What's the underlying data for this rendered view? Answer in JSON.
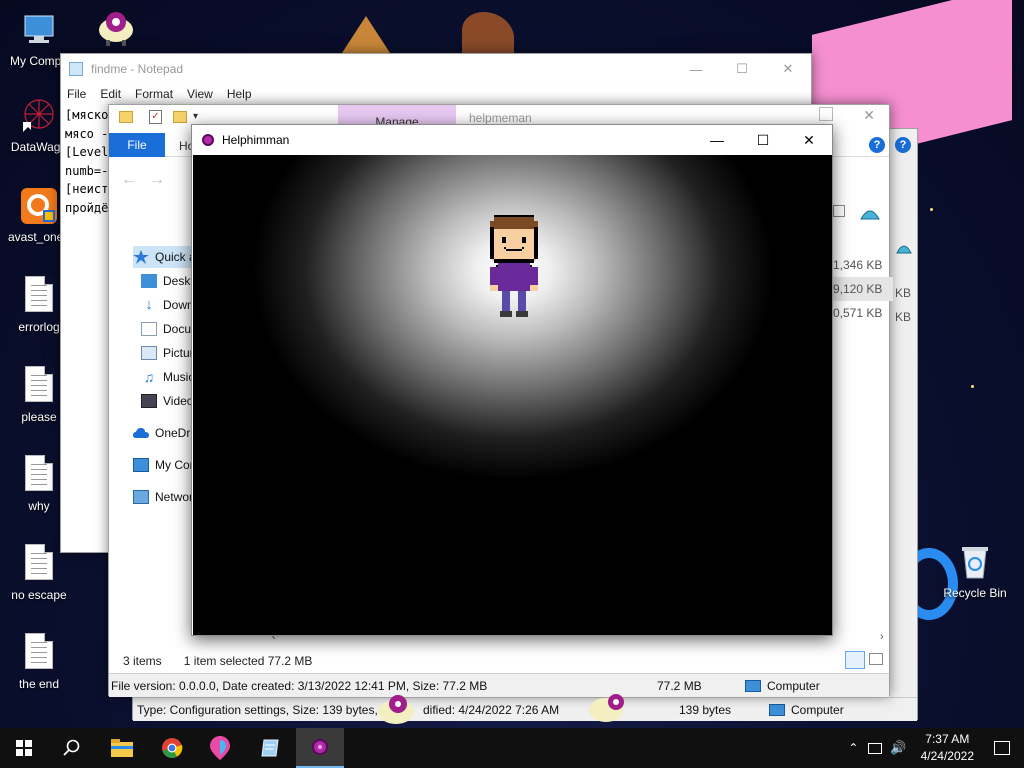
{
  "desktop": {
    "icons": [
      {
        "label": "My Compu",
        "icon": "computer-icon"
      },
      {
        "label": "DataWago",
        "icon": "datawagon-icon"
      },
      {
        "label": "avast_one_",
        "icon": "avast-icon"
      },
      {
        "label": "errorlog",
        "icon": "document-icon"
      },
      {
        "label": "please",
        "icon": "document-icon"
      },
      {
        "label": "why",
        "icon": "document-icon"
      },
      {
        "label": "no escape",
        "icon": "document-icon"
      },
      {
        "label": "the end",
        "icon": "document-icon"
      },
      {
        "label": "Recycle Bin",
        "icon": "recycle-bin-icon"
      }
    ]
  },
  "notepad": {
    "title": "findme - Notepad",
    "menu": [
      "File",
      "Edit",
      "Format",
      "View",
      "Help"
    ],
    "lines": [
      "[мяско",
      "мясо -",
      "[Level",
      "numb=-",
      "[неист",
      "пройдё"
    ]
  },
  "explorer_back": {
    "details": {
      "type_text": "Type: Configuration settings, Size: 139 bytes, D",
      "modified_text": "dified: 4/24/2022 7:26 AM",
      "size": "139 bytes",
      "location": "Computer"
    }
  },
  "explorer": {
    "manage_tab": "Manage",
    "title": "helpmeman",
    "file_tab": "File",
    "home_tab": "Ho",
    "nav": [
      "Quick a",
      "Deskt",
      "Down",
      "Docu",
      "Pictur",
      "Music",
      "Video",
      "OneDriv",
      "My Cor",
      "Networ"
    ],
    "file_sizes": [
      "1,346 KB",
      "9,120 KB",
      "0,571 KB"
    ],
    "file_sizes_back": [
      "KB",
      "KB"
    ],
    "status": {
      "items": "3 items",
      "selected": "1 item selected  77.2 MB"
    },
    "details": {
      "text": "File version: 0.0.0.0, Date created: 3/13/2022 12:41 PM, Size: 77.2 MB",
      "size": "77.2 MB",
      "location": "Computer"
    }
  },
  "game": {
    "title": "Helphimman"
  },
  "taskbar": {
    "apps": [
      "start-icon",
      "search-icon",
      "file-explorer-icon",
      "chrome-icon",
      "paint3d-icon",
      "notepad-icon",
      "helphimman-icon"
    ],
    "time": "7:37 AM",
    "date": "4/24/2022"
  },
  "colors": {
    "desktop_bg": "#0a0f2e",
    "pink": "#f58fd0",
    "explorer_file_tab": "#1a6ed8",
    "manage_tab": "#e8c9f2",
    "taskbar": "#101010"
  }
}
